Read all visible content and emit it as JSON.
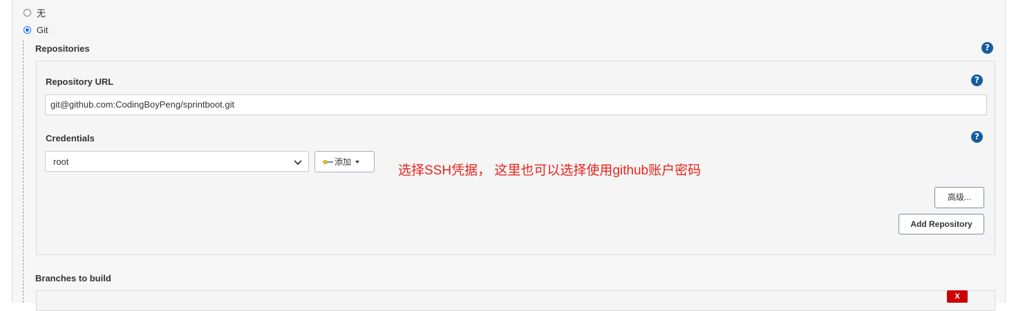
{
  "scm_options": [
    {
      "label": "无",
      "selected": false
    },
    {
      "label": "Git",
      "selected": true
    }
  ],
  "repositories": {
    "title": "Repositories",
    "help": "?",
    "repository_url": {
      "label": "Repository URL",
      "value": "git@github.com:CodingBoyPeng/sprintboot.git",
      "help": "?"
    },
    "credentials": {
      "label": "Credentials",
      "selected": "root",
      "add_label": "添加",
      "help": "?"
    },
    "annotation": "选择SSH凭据， 这里也可以选择使用github账户密码",
    "advanced_label": "高级...",
    "add_repository_label": "Add Repository"
  },
  "branches": {
    "title": "Branches to build",
    "delete_label": "X"
  },
  "colors": {
    "accent": "#135d9e",
    "annotation": "#e8241b",
    "delete": "#cc0000"
  }
}
